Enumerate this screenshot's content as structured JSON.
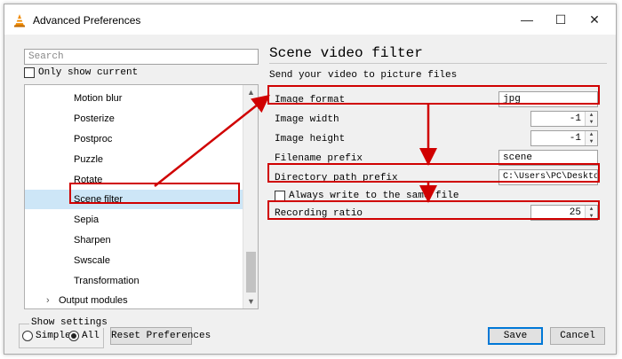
{
  "window": {
    "title": "Advanced Preferences",
    "minimize_glyph": "—",
    "maximize_glyph": "☐",
    "close_glyph": "✕"
  },
  "sidebar": {
    "search_placeholder": "Search",
    "only_show_current": "Only show current",
    "tree_items": [
      {
        "label": "Motion blur"
      },
      {
        "label": "Posterize"
      },
      {
        "label": "Postproc"
      },
      {
        "label": "Puzzle"
      },
      {
        "label": "Rotate"
      },
      {
        "label": "Scene filter",
        "selected": true
      },
      {
        "label": "Sepia"
      },
      {
        "label": "Sharpen"
      },
      {
        "label": "Swscale"
      },
      {
        "label": "Transformation"
      }
    ],
    "parent_item": {
      "label": "Output modules",
      "expander": "›"
    }
  },
  "panel": {
    "title": "Scene video filter",
    "description": "Send your video to picture files",
    "fields": {
      "image_format": {
        "label": "Image format",
        "value": "jpg"
      },
      "image_width": {
        "label": "Image width",
        "value": "-1"
      },
      "image_height": {
        "label": "Image height",
        "value": "-1"
      },
      "filename_prefix": {
        "label": "Filename prefix",
        "value": "scene"
      },
      "directory_path_prefix": {
        "label": "Directory path prefix",
        "value": "C:\\Users\\PC\\Desktop"
      },
      "always_write_same_file": {
        "label": "Always write to the same file",
        "checked": false
      },
      "recording_ratio": {
        "label": "Recording ratio",
        "value": "25"
      }
    }
  },
  "footer": {
    "show_settings_title": "Show settings",
    "simple_label": "Simple",
    "all_label": "All",
    "selected_mode": "All",
    "reset_label": "Reset Preferences",
    "save_label": "Save",
    "cancel_label": "Cancel"
  },
  "colors": {
    "annotation_red": "#d00000",
    "selection_blue": "#cde6f7",
    "default_button_border": "#0078d7"
  }
}
